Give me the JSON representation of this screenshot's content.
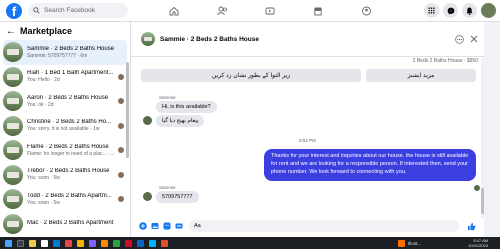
{
  "topbar": {
    "logo": "f",
    "search_placeholder": "Search Facebook",
    "nav_icons": [
      "home-icon",
      "friends-icon",
      "watch-icon",
      "marketplace-icon",
      "groups-icon"
    ],
    "right_icons": [
      "menu-grid-icon",
      "messenger-icon",
      "bell-icon",
      "account-avatar"
    ]
  },
  "sidebar": {
    "title": "Marketplace",
    "back_icon": "arrow-left-icon",
    "conversations": [
      {
        "title": "Sammie · 2 Beds 2 Baths House",
        "subtitle": "Sammie: 5709757777 · 6m",
        "active": true
      },
      {
        "title": "Riah · 1 Bed 1 Bath Apartment...",
        "subtitle": "You: Hello · 2d"
      },
      {
        "title": "Aaron · 2 Beds 2 Baths House",
        "subtitle": "You: ok · 2d"
      },
      {
        "title": "Christine · 2 Beds 2 Baths Ho...",
        "subtitle": "You: sorry. it is not available · 1w"
      },
      {
        "title": "Flame · 2 Beds 2 Baths House",
        "subtitle": "Flame: ho longer in need of a plac... · 1w"
      },
      {
        "title": "Trebor · 2 Beds 2 Baths House",
        "subtitle": "You: soon · 5w"
      },
      {
        "title": "Todd · 2 Beds 2 Baths Apartm...",
        "subtitle": "You: soon · 5w"
      },
      {
        "title": "Mac · 2 Beds 2 Baths Apartment",
        "subtitle": ""
      }
    ]
  },
  "chat": {
    "title": "Sammie · 2 Beds 2 Baths House",
    "listing_line": "2 Beds 2 Baths House · $950",
    "action_buttons": [
      "زیر التوا کے بطور نشان زد کریں",
      "مزید ایشنز"
    ],
    "sender_name": "Sammie",
    "messages_in_1": [
      "Hi, is this available?",
      "پیغام بھیج دیا گیا"
    ],
    "timestamp": "8:52 PM",
    "message_out": "Thanks for your interest and inquiries about our house. the house is still available for rent and we are looking for a responsible person. If interested then, send your phone number. We look forward to connecting with you.",
    "sender_name_2": "Sammie",
    "message_in_2": "5709757777",
    "composer_value": "Aa"
  },
  "taskbar": {
    "window_label": "Illust...",
    "time": "5:47 AM",
    "date": "10/11/2023"
  },
  "colors": {
    "brand": "#1877f2",
    "outgoing_bubble": "#3b3fe0",
    "incoming_bubble": "#e4e6eb",
    "active_row": "#e7f0fd"
  }
}
